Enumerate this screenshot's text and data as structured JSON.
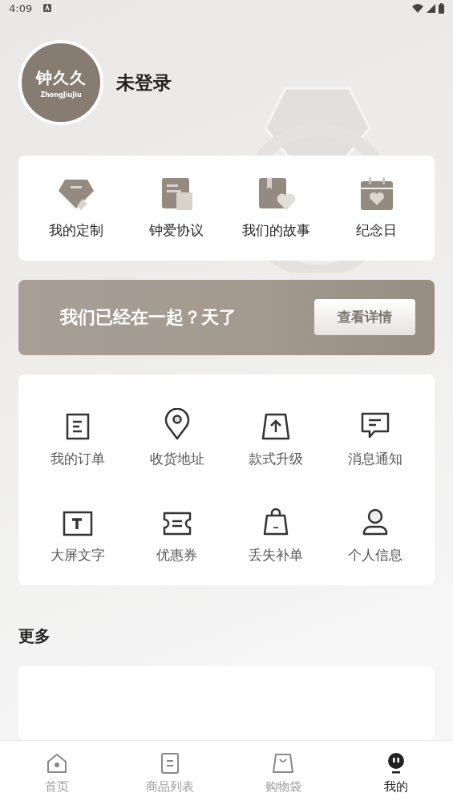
{
  "status_bar": {
    "time": "4:09"
  },
  "profile": {
    "logo_title": "钟久久",
    "logo_subtitle": "ZhongJiuJiu",
    "name": "未登录"
  },
  "features": [
    {
      "label": "我的定制",
      "kind": "diamond"
    },
    {
      "label": "钟爱协议",
      "kind": "document"
    },
    {
      "label": "我们的故事",
      "kind": "book"
    },
    {
      "label": "纪念日",
      "kind": "calendar"
    }
  ],
  "banner": {
    "text": "我们已经在一起？天了",
    "button": "查看详情"
  },
  "services": [
    {
      "label": "我的订单",
      "kind": "order"
    },
    {
      "label": "收货地址",
      "kind": "pin"
    },
    {
      "label": "款式升级",
      "kind": "upgrade"
    },
    {
      "label": "消息通知",
      "kind": "message"
    },
    {
      "label": "大屏文字",
      "kind": "text"
    },
    {
      "label": "优惠券",
      "kind": "coupon"
    },
    {
      "label": "丢失补单",
      "kind": "bag"
    },
    {
      "label": "个人信息",
      "kind": "person"
    }
  ],
  "more": {
    "title": "更多"
  },
  "tabs": [
    {
      "label": "首页",
      "kind": "home",
      "selected": false
    },
    {
      "label": "商品列表",
      "kind": "list",
      "selected": false
    },
    {
      "label": "购物袋",
      "kind": "bag",
      "selected": false
    },
    {
      "label": "我的",
      "kind": "me",
      "selected": true
    }
  ]
}
